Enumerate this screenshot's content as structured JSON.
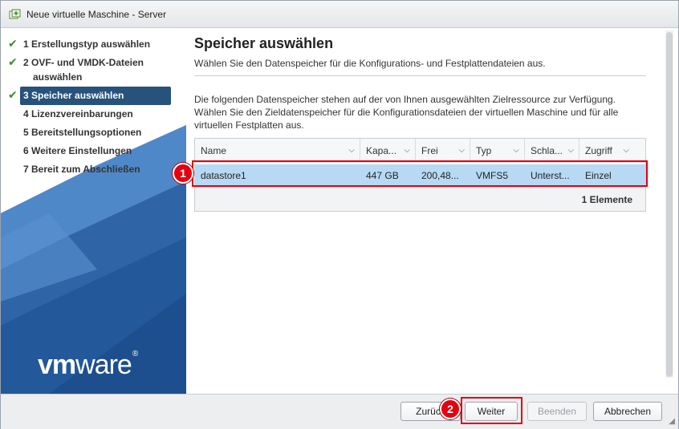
{
  "window": {
    "title": "Neue virtuelle Maschine - Server"
  },
  "wizard": {
    "steps": [
      {
        "label": "1 Erstellungstyp auswählen",
        "done": true
      },
      {
        "label": "2 OVF- und VMDK-Dateien",
        "label2": "auswählen",
        "done": true
      },
      {
        "label": "3 Speicher auswählen",
        "done": true,
        "active": true
      },
      {
        "label": "4 Lizenzvereinbarungen",
        "done": false
      },
      {
        "label": "5 Bereitstellungsoptionen",
        "done": false
      },
      {
        "label": "6 Weitere Einstellungen",
        "done": false
      },
      {
        "label": "7 Bereit zum Abschließen",
        "done": false
      }
    ],
    "logo": {
      "vm": "vm",
      "ware": "ware",
      "reg": "®"
    }
  },
  "page": {
    "title": "Speicher auswählen",
    "subtitle": "Wählen Sie den Datenspeicher für die Konfigurations- und Festplattendateien aus.",
    "description_line1": "Die folgenden Datenspeicher stehen auf der von Ihnen ausgewählten Zielressource zur Verfügung.",
    "description_line2": "Wählen Sie den Zieldatenspeicher für die Konfigurationsdateien der virtuellen Maschine und für alle",
    "description_line3": "virtuellen Festplatten aus."
  },
  "table": {
    "columns": [
      "Name",
      "Kapa...",
      "Frei",
      "Typ",
      "Schla...",
      "Zugriff"
    ],
    "rows": [
      [
        "datastore1",
        "447 GB",
        "200,48...",
        "VMFS5",
        "Unterst...",
        "Einzel"
      ]
    ],
    "footer": "1 Elemente"
  },
  "buttons": {
    "back": "Zurück",
    "next": "Weiter",
    "finish": "Beenden",
    "cancel": "Abbrechen"
  },
  "annotations": {
    "badge1": "1",
    "badge2": "2",
    "color": "#e3000f"
  },
  "colors": {
    "active_step": "#26527c",
    "selected_row": "#b8d9f4",
    "check": "#3c8d2c",
    "vmware_blue": "#3a6fae"
  }
}
